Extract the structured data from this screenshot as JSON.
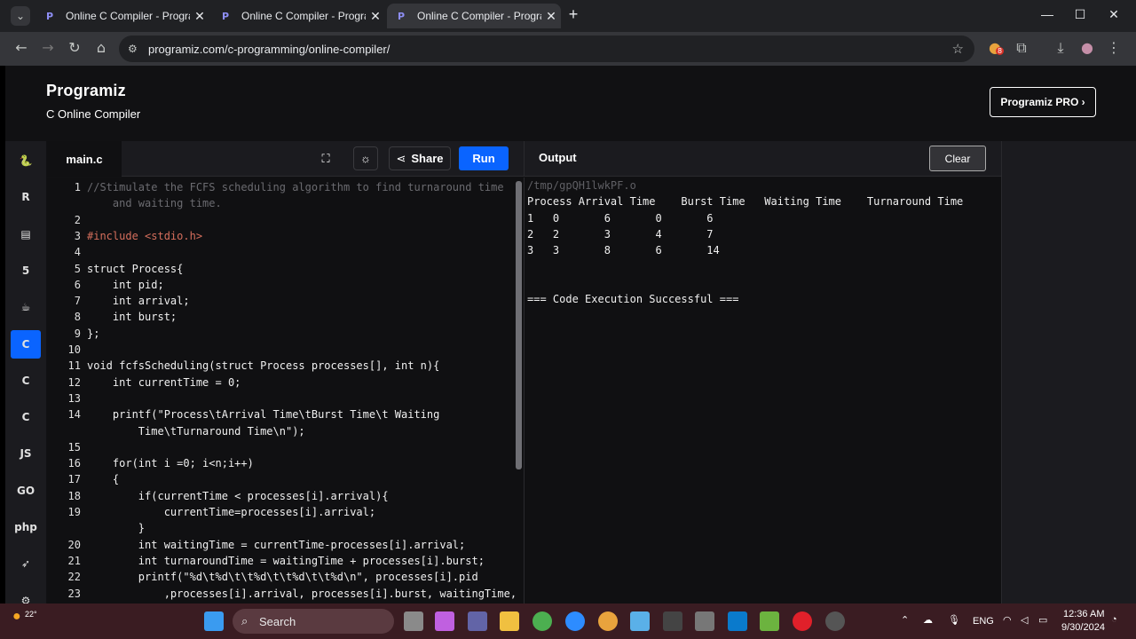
{
  "browser": {
    "tabs": [
      {
        "title": "Online C Compiler - Programiz",
        "active": false
      },
      {
        "title": "Online C Compiler - Programiz",
        "active": false
      },
      {
        "title": "Online C Compiler - Programiz",
        "active": true
      }
    ],
    "url": "programiz.com/c-programming/online-compiler/",
    "extension_badge": "8"
  },
  "site": {
    "logo": "Programiz",
    "subtitle": "C Online Compiler",
    "pro_button": "Programiz PRO ›"
  },
  "sidebar": {
    "items": [
      {
        "icon": "python-icon",
        "glyph": "🐍",
        "active": false
      },
      {
        "icon": "r-icon",
        "glyph": "R",
        "active": false
      },
      {
        "icon": "sql-icon",
        "glyph": "▤",
        "active": false
      },
      {
        "icon": "html-icon",
        "glyph": "5",
        "active": false
      },
      {
        "icon": "java-icon",
        "glyph": "☕",
        "active": false
      },
      {
        "icon": "c-icon",
        "glyph": "C",
        "active": true
      },
      {
        "icon": "cpp-icon",
        "glyph": "C",
        "active": false
      },
      {
        "icon": "csharp-icon",
        "glyph": "C",
        "active": false
      },
      {
        "icon": "js-icon",
        "glyph": "JS",
        "active": false
      },
      {
        "icon": "go-icon",
        "glyph": "GO",
        "active": false
      },
      {
        "icon": "php-icon",
        "glyph": "php",
        "active": false
      },
      {
        "icon": "swift-icon",
        "glyph": "➶",
        "active": false
      },
      {
        "icon": "rust-icon",
        "glyph": "⚙",
        "active": false
      }
    ]
  },
  "editor": {
    "filename": "main.c",
    "share_label": "Share",
    "run_label": "Run",
    "lines": [
      {
        "n": "1",
        "text": "//Stimulate the FCFS scheduling algorithm to find turnaround time",
        "cls": "cmt"
      },
      {
        "n": "",
        "text": "    and waiting time.",
        "cls": "cmt"
      },
      {
        "n": "2",
        "text": "",
        "cls": ""
      },
      {
        "n": "3",
        "text": "#include <stdio.h>",
        "cls": "inc"
      },
      {
        "n": "4",
        "text": "",
        "cls": ""
      },
      {
        "n": "5",
        "text": "struct Process{",
        "cls": ""
      },
      {
        "n": "6",
        "text": "    int pid;",
        "cls": ""
      },
      {
        "n": "7",
        "text": "    int arrival;",
        "cls": ""
      },
      {
        "n": "8",
        "text": "    int burst;",
        "cls": ""
      },
      {
        "n": "9",
        "text": "};",
        "cls": ""
      },
      {
        "n": "10",
        "text": "",
        "cls": ""
      },
      {
        "n": "11",
        "text": "void fcfsScheduling(struct Process processes[], int n){",
        "cls": ""
      },
      {
        "n": "12",
        "text": "    int currentTime = 0;",
        "cls": ""
      },
      {
        "n": "13",
        "text": "",
        "cls": ""
      },
      {
        "n": "14",
        "text": "    printf(\"Process\\tArrival Time\\tBurst Time\\t Waiting",
        "cls": ""
      },
      {
        "n": "",
        "text": "        Time\\tTurnaround Time\\n\");",
        "cls": ""
      },
      {
        "n": "15",
        "text": "",
        "cls": ""
      },
      {
        "n": "16",
        "text": "    for(int i =0; i<n;i++)",
        "cls": ""
      },
      {
        "n": "17",
        "text": "    {",
        "cls": ""
      },
      {
        "n": "18",
        "text": "        if(currentTime < processes[i].arrival){",
        "cls": ""
      },
      {
        "n": "19",
        "text": "            currentTime=processes[i].arrival;",
        "cls": ""
      },
      {
        "n": "",
        "text": "        }",
        "cls": ""
      },
      {
        "n": "20",
        "text": "        int waitingTime = currentTime-processes[i].arrival;",
        "cls": ""
      },
      {
        "n": "21",
        "text": "        int turnaroundTime = waitingTime + processes[i].burst;",
        "cls": ""
      },
      {
        "n": "22",
        "text": "        printf(\"%d\\t%d\\t\\t%d\\t\\t%d\\t\\t%d\\n\", processes[i].pid",
        "cls": ""
      },
      {
        "n": "23",
        "text": "            ,processes[i].arrival, processes[i].burst, waitingTime,",
        "cls": ""
      }
    ]
  },
  "output": {
    "title": "Output",
    "clear_label": "Clear",
    "lines": [
      {
        "text": "/tmp/gpQH1lwkPF.o",
        "dim": true
      },
      {
        "text": "Process Arrival Time    Burst Time   Waiting Time    Turnaround Time",
        "dim": false
      },
      {
        "text": "1   0       6       0       6",
        "dim": false
      },
      {
        "text": "2   2       3       4       7",
        "dim": false
      },
      {
        "text": "3   3       8       6       14",
        "dim": false
      },
      {
        "text": "",
        "dim": false
      },
      {
        "text": "",
        "dim": false
      },
      {
        "text": "=== Code Execution Successful ===",
        "dim": false
      }
    ]
  },
  "taskbar": {
    "weather": "22°",
    "search_placeholder": "Search",
    "language": "ENG",
    "time": "12:36 AM",
    "date": "9/30/2024"
  }
}
